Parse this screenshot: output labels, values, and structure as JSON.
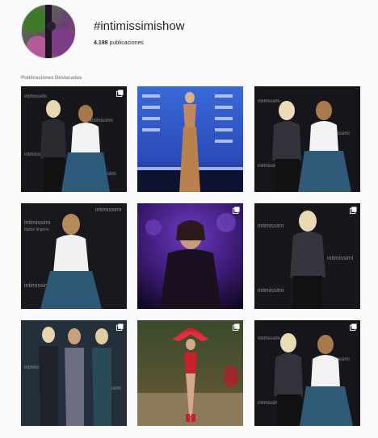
{
  "profile": {
    "hashtag": "#intimissimishow",
    "post_count": "4.198",
    "post_label": "publicaciones"
  },
  "featured": {
    "label": "Publicaciones Destacadas"
  },
  "brand": {
    "name": "intimissimi",
    "tagline": "Italian lingerie"
  },
  "posts": [
    {
      "multi": true
    },
    {
      "multi": false
    },
    {
      "multi": false
    },
    {
      "multi": false
    },
    {
      "multi": true
    },
    {
      "multi": true
    },
    {
      "multi": true
    },
    {
      "multi": true
    },
    {
      "multi": true
    }
  ],
  "colors": {
    "text": "#262626",
    "muted": "#8e8e8e",
    "background": "#fafafa"
  }
}
